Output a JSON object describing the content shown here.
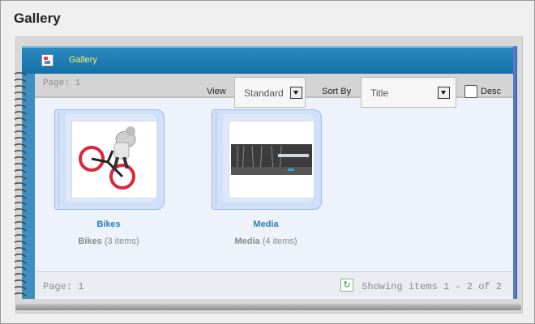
{
  "page": {
    "title": "Gallery"
  },
  "header": {
    "icon": "gallery-icon",
    "label": "Gallery"
  },
  "toolbar": {
    "page_label": "Page: 1",
    "view_label": "View",
    "view_value": "Standard",
    "sort_label": "Sort By",
    "sort_value": "Title",
    "desc_label": "Desc"
  },
  "albums": [
    {
      "name": "Bikes",
      "count_name": "Bikes",
      "count_text": "(3 items)",
      "thumb": "bmx-rider-photo"
    },
    {
      "name": "Media",
      "count_name": "Media",
      "count_text": "(4 items)",
      "thumb": "forest-banner-photo"
    }
  ],
  "footer": {
    "page_label": "Page: 1",
    "refresh_icon": "refresh-icon",
    "showing": "Showing items 1 - 2 of 2"
  }
}
